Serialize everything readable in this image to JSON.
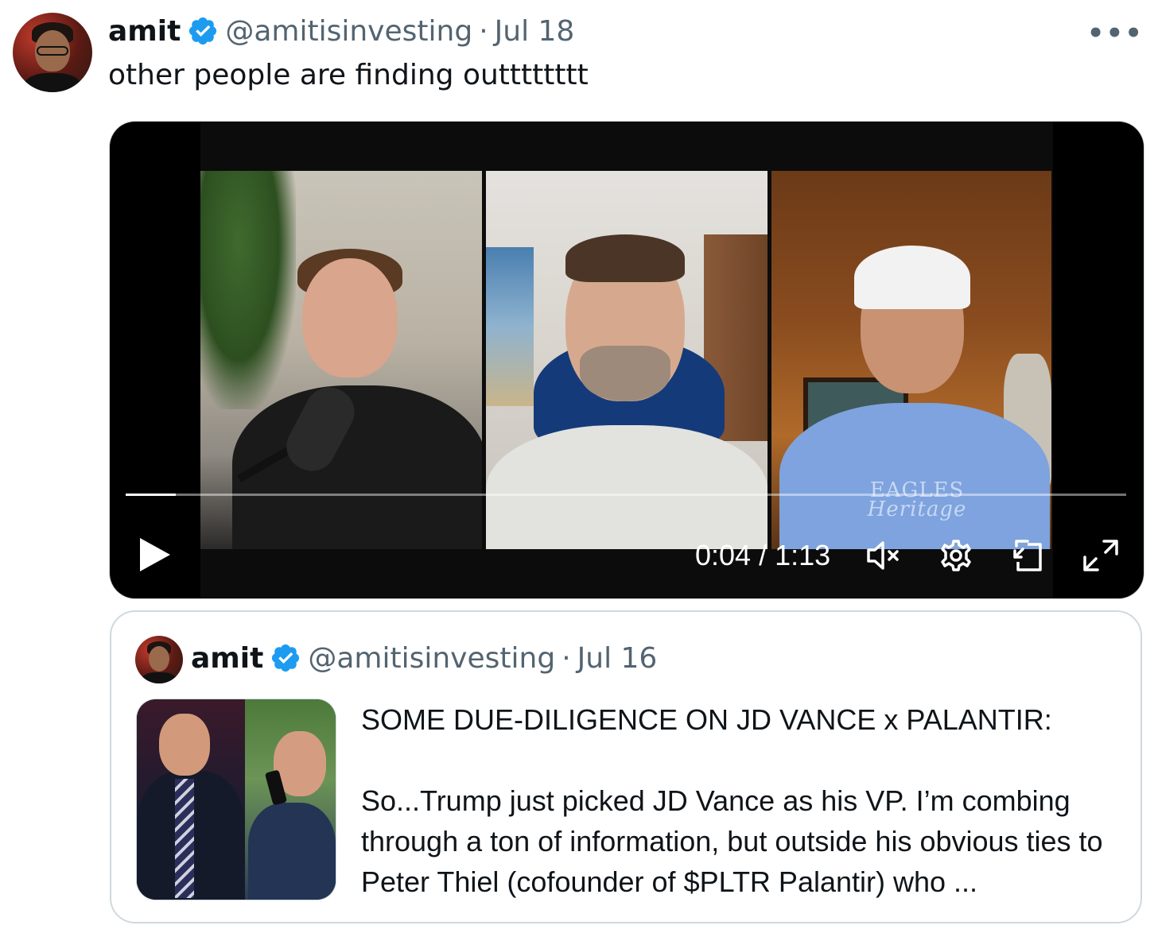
{
  "tweet": {
    "author_name": "amit",
    "handle": "@amitisinvesting",
    "separator": "·",
    "date": "Jul 18",
    "more_label": "•••",
    "text": "other people are finding outttttttt"
  },
  "video": {
    "current_time": "0:04",
    "duration": "1:13",
    "time_display": "0:04 / 1:13",
    "progress_fraction": 0.05,
    "shirt_text_line1": "EAGLES",
    "shirt_text_line2": "Heritage"
  },
  "icons": {
    "verified": "verified-badge-icon",
    "play": "play-icon",
    "mute": "volume-muted-icon",
    "settings": "gear-icon",
    "pip": "picture-in-picture-icon",
    "fullscreen": "fullscreen-icon",
    "more": "more-dots-icon"
  },
  "quote": {
    "author_name": "amit",
    "handle": "@amitisinvesting",
    "separator": "·",
    "date": "Jul 16",
    "headline": "SOME DUE-DILIGENCE ON JD VANCE x PALANTIR:",
    "body": "So...Trump just picked JD Vance as his VP. I’m combing through a ton of information, but outside his obvious ties to Peter Thiel (cofounder of $PLTR Palantir) who ..."
  },
  "colors": {
    "text_primary": "#0f1419",
    "text_secondary": "#536471",
    "verified_blue": "#1d9bf0",
    "border": "#cfd9de",
    "video_bg": "#000000"
  }
}
